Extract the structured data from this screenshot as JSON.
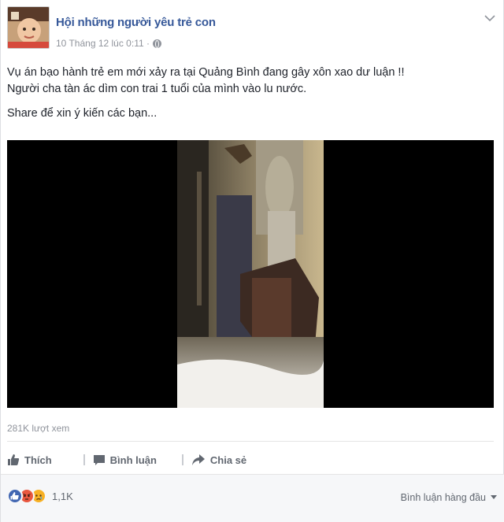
{
  "post": {
    "page_name": "Hội những người yêu trẻ con",
    "timestamp": "10 Tháng 12 lúc 0:11 ·",
    "lines": [
      "Vụ án bạo hành trẻ em mới xảy ra tại Quảng Bình đang gây xôn xao dư luận !!",
      "Người cha tàn ác dìm con trai 1 tuổi của mình vào lu nước.",
      "Share để xin ý kiến các bạn..."
    ],
    "view_count": "281K lượt xem"
  },
  "actions": {
    "like": "Thích",
    "comment": "Bình luận",
    "share": "Chia sẻ"
  },
  "footer": {
    "reaction_count": "1,1K",
    "sort_label": "Bình luận hàng đầu"
  },
  "colors": {
    "link": "#365899",
    "muted": "#90949c",
    "action": "#616770",
    "like_blue": "#4267b2",
    "angry_red": "#e9573f",
    "sad_yellow": "#f7b125"
  },
  "icons": [
    "avatar-image",
    "globe-icon",
    "chevron-down-icon",
    "like-icon",
    "comment-icon",
    "share-icon",
    "like-reaction-icon",
    "angry-reaction-icon",
    "sad-reaction-icon",
    "sort-caret-icon"
  ]
}
